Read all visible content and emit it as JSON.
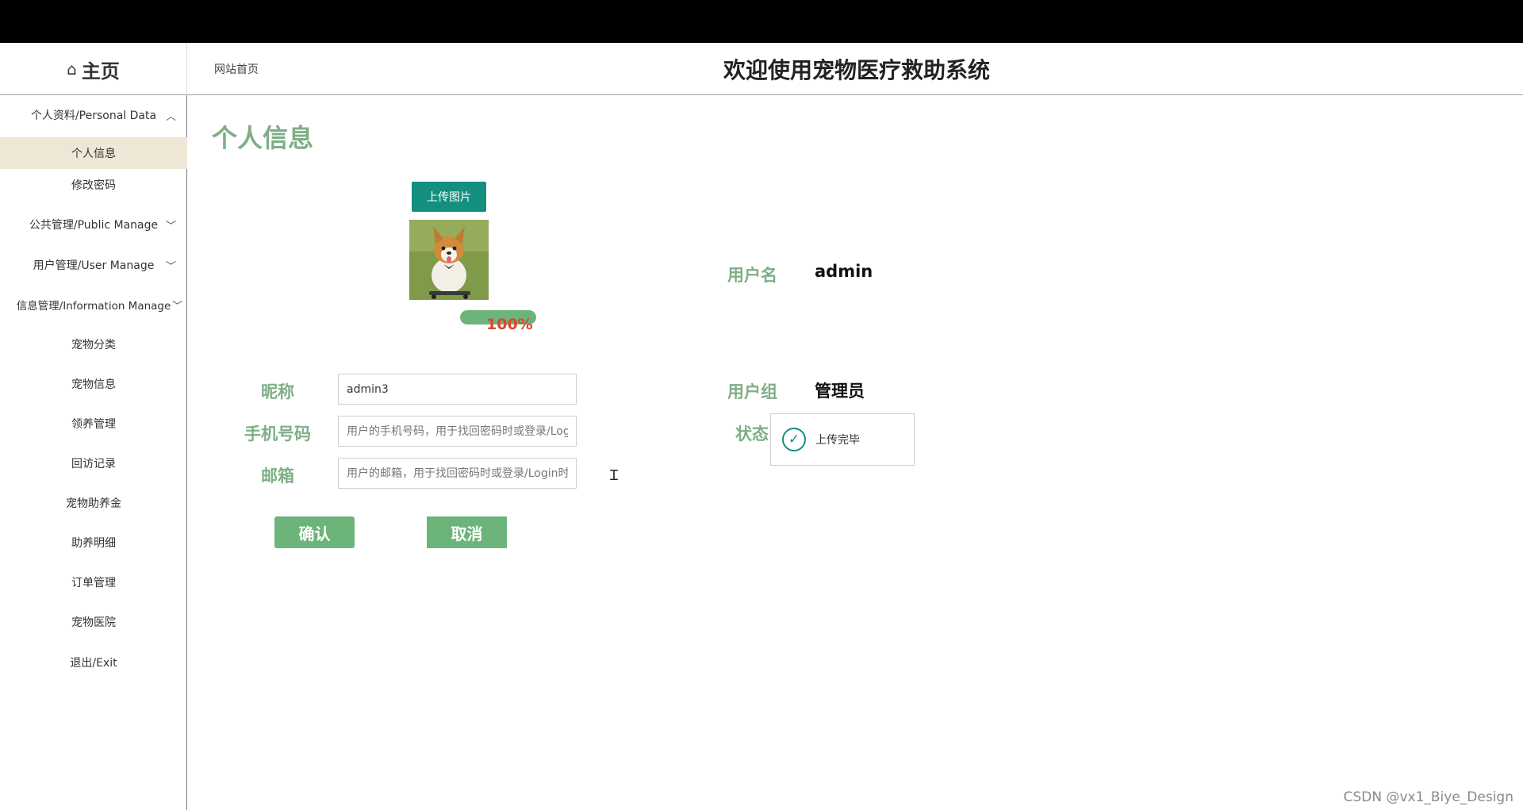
{
  "header": {
    "home_label": "主页",
    "home_icon": "home-icon",
    "breadcrumb": "网站首页",
    "system_title": "欢迎使用宠物医疗救助系统"
  },
  "sidebar": {
    "groups": [
      {
        "label": "个人资料/Personal Data",
        "expanded": true
      },
      {
        "label": "公共管理/Public Manage",
        "expanded": false
      },
      {
        "label": "用户管理/User Manage",
        "expanded": false
      },
      {
        "label": "信息管理/Information Manage",
        "expanded": false
      }
    ],
    "personal_items": [
      {
        "label": "个人信息",
        "active": true
      },
      {
        "label": "修改密码",
        "active": false
      }
    ],
    "items": [
      {
        "label": "宠物分类"
      },
      {
        "label": "宠物信息"
      },
      {
        "label": "领养管理"
      },
      {
        "label": "回访记录"
      },
      {
        "label": "宠物助养金"
      },
      {
        "label": "助养明细"
      },
      {
        "label": "订单管理"
      },
      {
        "label": "宠物医院"
      },
      {
        "label": "退出/Exit"
      }
    ],
    "active_bg": "#efe7d6"
  },
  "main": {
    "page_title": "个人信息",
    "upload_button": "上传图片",
    "upload_progress_percent": 100,
    "upload_progress_text": "100%",
    "form": {
      "nickname_label": "昵称",
      "nickname_value": "admin3",
      "phone_label": "手机号码",
      "phone_placeholder": "用户的手机号码，用于找回密码时或登录/Login时",
      "email_label": "邮箱",
      "email_placeholder": "用户的邮箱，用于找回密码时或登录/Login时",
      "confirm_button": "确认",
      "cancel_button": "取消"
    },
    "info": {
      "username_label": "用户名",
      "username_value": "admin",
      "group_label": "用户组",
      "group_value": "管理员",
      "status_label": "状态"
    },
    "toast": {
      "text": "上传完毕",
      "icon": "check-circle-icon"
    }
  },
  "colors": {
    "accent_green": "#7fae86",
    "button_green": "#6cb47a",
    "teal": "#13907f",
    "progress_text": "#d9472f"
  },
  "watermark": "CSDN @vx1_Biye_Design"
}
